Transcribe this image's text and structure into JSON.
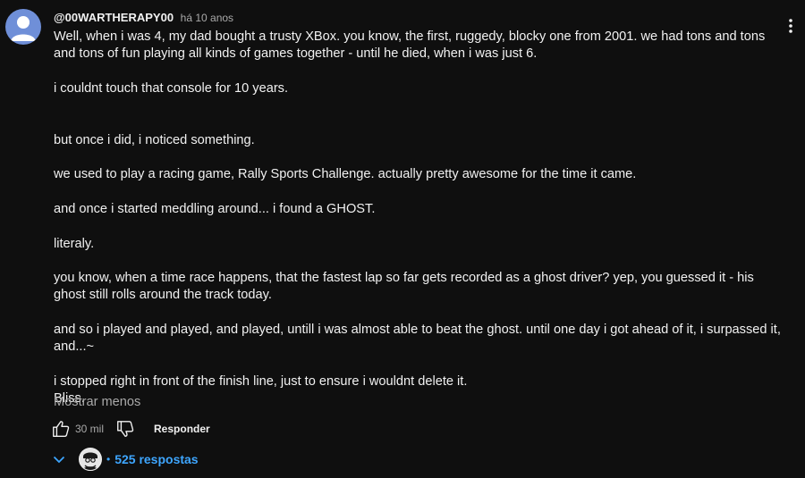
{
  "comment": {
    "author": "@00WARTHERAPY00",
    "time": "há 10 anos",
    "paragraphs": [
      [
        "Well, when i was 4, my dad bought a trusty XBox. you know, the first, ruggedy, blocky one from 2001. we had tons and tons and tons of fun playing all kinds of games together - until he died, when i was just 6."
      ],
      [
        "i couldnt touch that console for 10 years."
      ],
      [
        ""
      ],
      [
        "but once i did, i noticed something."
      ],
      [
        "we used to play a racing game, Rally Sports Challenge. actually pretty awesome for the time it came."
      ],
      [
        "and once i started meddling around... i found a GHOST."
      ],
      [
        "literaly."
      ],
      [
        "you know, when a time race happens, that the fastest lap so far gets recorded as a ghost driver? yep, you guessed it - his ghost still rolls around the track today."
      ],
      [
        "and so i played and played, and played, untill i was almost able to beat the ghost. until one day i got ahead of it, i surpassed it, and...~"
      ],
      [
        "i stopped right in front of the finish line, just to ensure i wouldnt delete it.",
        "Bliss."
      ]
    ],
    "show_less": "Mostrar menos",
    "like_count": "30 mil",
    "reply_label": "Responder",
    "replies_dot": "•",
    "replies_count": "525 respostas"
  },
  "icons": {
    "avatar": "user-avatar",
    "menu": "more-vert-icon",
    "like": "thumb-up-icon",
    "dislike": "thumb-down-icon",
    "expand": "chevron-down-icon",
    "reply_avatar": "creator-avatar"
  },
  "colors": {
    "background": "#0f0f0f",
    "text": "#f1f1f1",
    "secondary": "#aaaaaa",
    "link": "#3ea6ff",
    "avatar": "#6f8fd8"
  }
}
